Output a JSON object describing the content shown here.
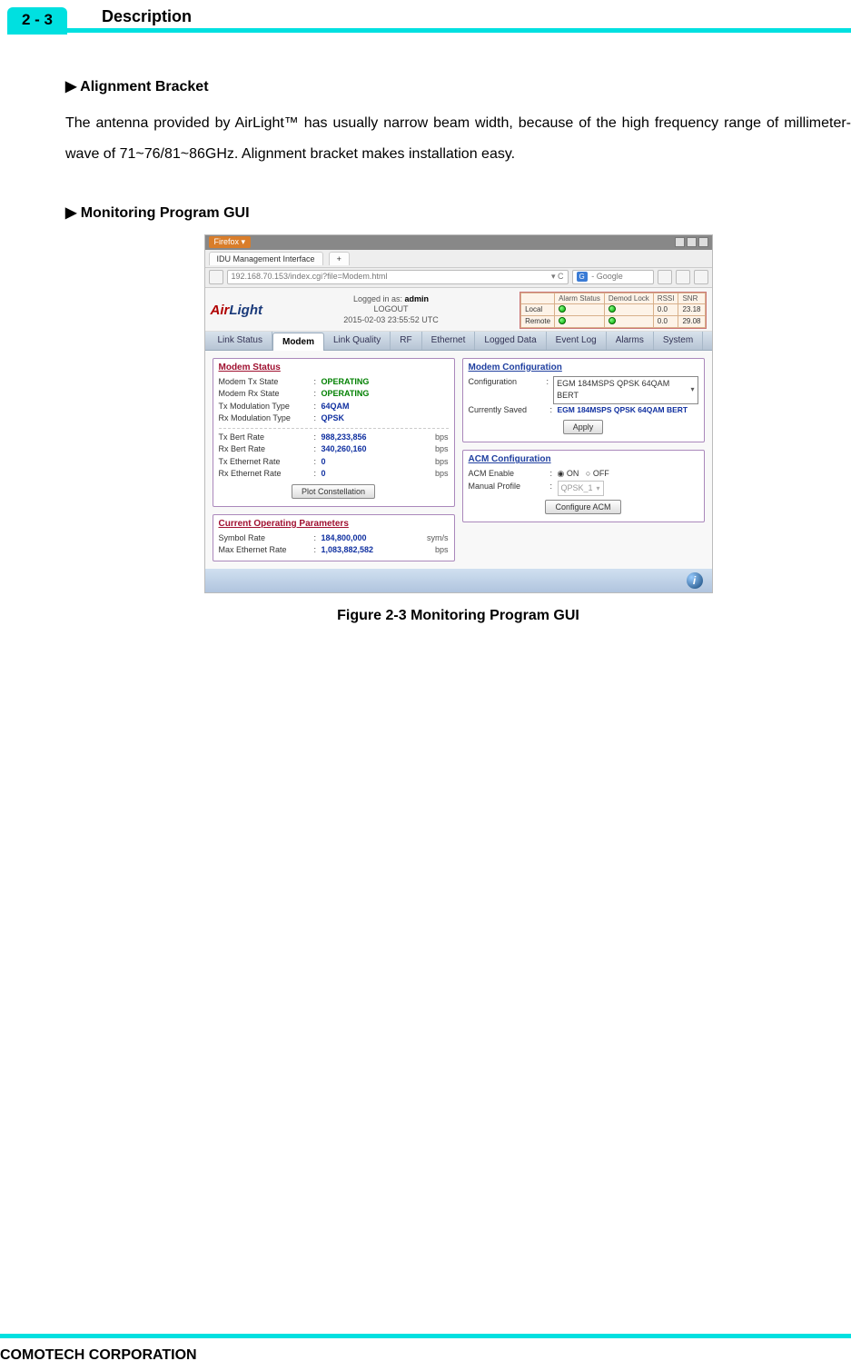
{
  "section": {
    "num": "2 - 3",
    "title": "Description"
  },
  "alignment": {
    "heading": "▶ Alignment Bracket",
    "text": "The antenna provided by AirLight™ has usually narrow beam width, because of the high frequency range of millimeter-wave of 71~76/81~86GHz. Alignment bracket makes installation easy."
  },
  "monitoring": {
    "heading": "▶ Monitoring Program GUI"
  },
  "figure_caption": "Figure 2-3 Monitoring Program GUI",
  "footer": "COMOTECH CORPORATION",
  "gui": {
    "firefox_label": "Firefox ▾",
    "tab_title": "IDU Management Interface",
    "tab_plus": "+",
    "url": "192.168.70.153/index.cgi?file=Modem.html",
    "url_suffix": "▾ C",
    "google_prefix": "G",
    "google_placeholder": " - Google",
    "logo_air": "Air",
    "logo_light": "Light",
    "logged_in_label": "Logged in as: ",
    "logged_in_user": "admin",
    "logout": "LOGOUT",
    "timestamp": "2015-02-03 23:55:52 UTC",
    "status_headers": [
      "",
      "Alarm Status",
      "Demod Lock",
      "RSSI",
      "SNR"
    ],
    "status_rows": [
      {
        "label": "Local",
        "rssi": "0.0",
        "snr": "23.18"
      },
      {
        "label": "Remote",
        "rssi": "0.0",
        "snr": "29.08"
      }
    ],
    "tabs": [
      "Link Status",
      "Modem",
      "Link Quality",
      "RF",
      "Ethernet",
      "Logged Data",
      "Event Log",
      "Alarms",
      "System"
    ],
    "active_tab": "Modem",
    "modem_status": {
      "title": "Modem Status",
      "rows_a": [
        {
          "k": "Modem Tx State",
          "v": "OPERATING",
          "cls": "green"
        },
        {
          "k": "Modem Rx State",
          "v": "OPERATING",
          "cls": "green"
        },
        {
          "k": "Tx Modulation Type",
          "v": "64QAM"
        },
        {
          "k": "Rx Modulation Type",
          "v": "QPSK"
        }
      ],
      "rows_b": [
        {
          "k": "Tx Bert Rate",
          "v": "988,233,856",
          "u": "bps"
        },
        {
          "k": "Rx Bert Rate",
          "v": "340,260,160",
          "u": "bps"
        },
        {
          "k": "Tx Ethernet Rate",
          "v": "0",
          "u": "bps"
        },
        {
          "k": "Rx Ethernet Rate",
          "v": "0",
          "u": "bps"
        }
      ],
      "btn": "Plot Constellation"
    },
    "current_params": {
      "title": "Current Operating Parameters",
      "rows": [
        {
          "k": "Symbol Rate",
          "v": "184,800,000",
          "u": "sym/s"
        },
        {
          "k": "Max Ethernet Rate",
          "v": "1,083,882,582",
          "u": "bps"
        }
      ]
    },
    "modem_config": {
      "title": "Modem Configuration",
      "config_label": "Configuration",
      "config_value": "EGM 184MSPS QPSK 64QAM BERT",
      "saved_label": "Currently Saved",
      "saved_value": "EGM 184MSPS QPSK 64QAM BERT",
      "btn": "Apply"
    },
    "acm_config": {
      "title": "ACM Configuration",
      "enable_label": "ACM Enable",
      "on": "ON",
      "off": "OFF",
      "profile_label": "Manual Profile",
      "profile_value": "QPSK_1",
      "btn": "Configure ACM"
    },
    "info_icon": "i"
  }
}
